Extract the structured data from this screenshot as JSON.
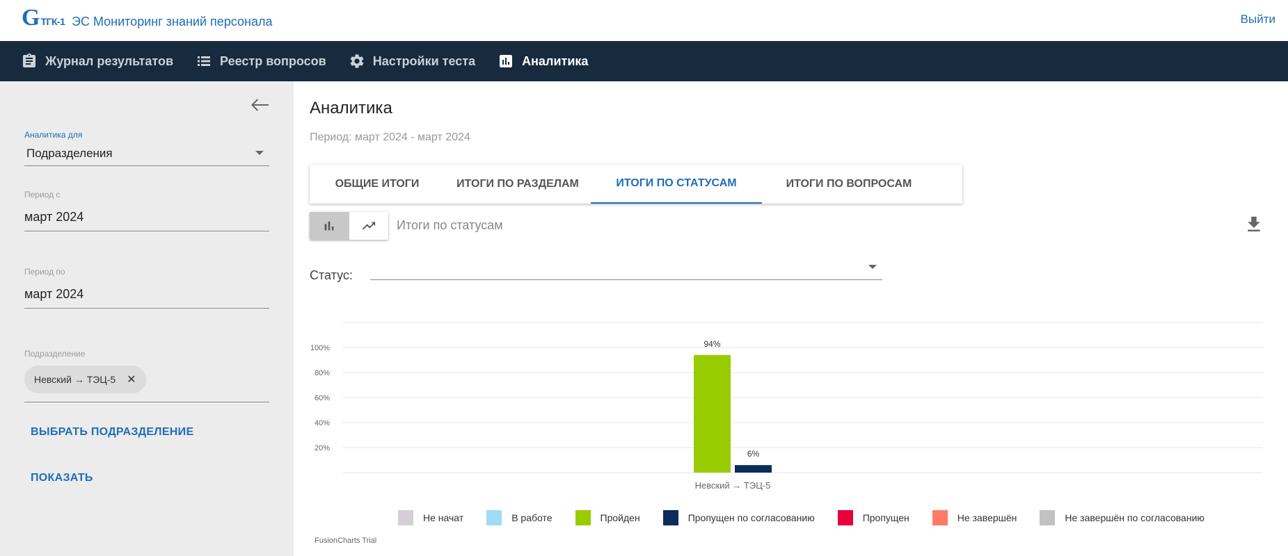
{
  "header": {
    "logo_letter": "G",
    "logo_text": "ТГК-1",
    "app_title": "ЭС Мониторинг знаний персонала",
    "logout": "Выйти"
  },
  "nav": {
    "items": [
      {
        "label": "Журнал результатов",
        "icon": "clipboard-icon",
        "active": false
      },
      {
        "label": "Реестр вопросов",
        "icon": "list-icon",
        "active": false
      },
      {
        "label": "Настройки теста",
        "icon": "gear-icon",
        "active": false
      },
      {
        "label": "Аналитика",
        "icon": "bar-chart-icon",
        "active": true
      }
    ]
  },
  "sidebar": {
    "analytics_for_label": "Аналитика для",
    "analytics_for_value": "Подразделения",
    "period_from_label": "Период с",
    "period_from_value": "март 2024",
    "period_to_label": "Период по",
    "period_to_value": "март 2024",
    "division_label": "Подразделение",
    "division_chip": "Невский → ТЭЦ-5",
    "select_division": "ВЫБРАТЬ ПОДРАЗДЕЛЕНИЕ",
    "show": "ПОКАЗАТЬ"
  },
  "main": {
    "title": "Аналитика",
    "period": "Период: март 2024 - март 2024",
    "tabs": [
      {
        "label": "ОБЩИЕ ИТОГИ",
        "active": false
      },
      {
        "label": "ИТОГИ ПО РАЗДЕЛАМ",
        "active": false
      },
      {
        "label": "ИТОГИ ПО СТАТУСАМ",
        "active": true
      },
      {
        "label": "ИТОГИ ПО ВОПРОСАМ",
        "active": false
      }
    ],
    "chart_caption": "Итоги по статусам",
    "status_label": "Статус:",
    "status_value": "",
    "trial": "FusionCharts Trial"
  },
  "chart_data": {
    "type": "bar",
    "categories": [
      "Невский → ТЭЦ-5"
    ],
    "series": [
      {
        "name": "Не начат",
        "color": "#d6ced6",
        "values": [
          0
        ]
      },
      {
        "name": "В работе",
        "color": "#9fdcf7",
        "values": [
          0
        ]
      },
      {
        "name": "Пройден",
        "color": "#99cc00",
        "values": [
          94
        ]
      },
      {
        "name": "Пропущен по согласованию",
        "color": "#0b2c5c",
        "values": [
          6
        ]
      },
      {
        "name": "Пропущен",
        "color": "#e8003d",
        "values": [
          0
        ]
      },
      {
        "name": "Не завершён",
        "color": "#ff7b65",
        "values": [
          0
        ]
      },
      {
        "name": "Не завершён по согласованию",
        "color": "#c2c2c2",
        "values": [
          0
        ]
      }
    ],
    "data_labels": [
      "94%",
      "6%"
    ],
    "y_ticks": [
      "20%",
      "40%",
      "60%",
      "80%",
      "100%"
    ],
    "ylim": [
      0,
      120
    ],
    "grid": true,
    "legend_position": "bottom"
  }
}
